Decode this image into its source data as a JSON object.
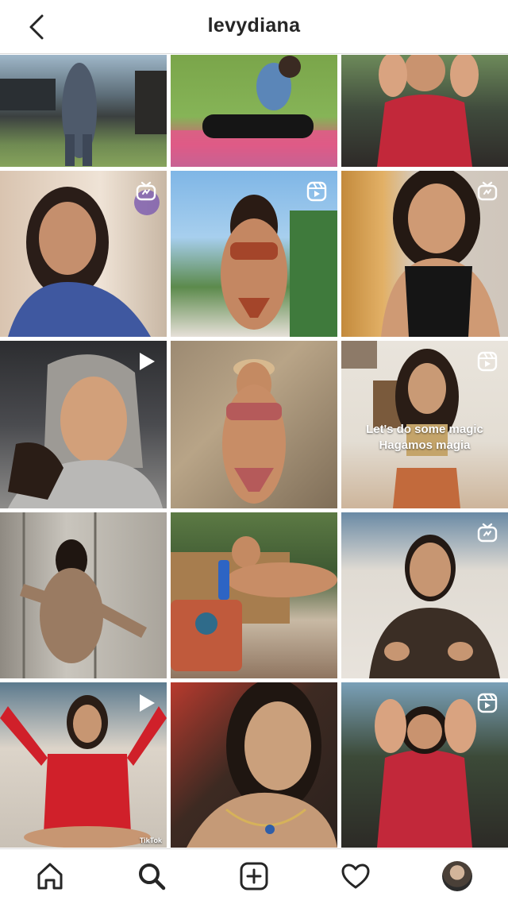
{
  "header": {
    "username": "levydiana"
  },
  "icons": {
    "back": "chevron-left-icon",
    "home": "home-icon",
    "search": "search-icon",
    "new_post": "add-post-icon",
    "activity": "heart-icon",
    "profile": "profile-avatar"
  },
  "tiles": [
    {
      "index": 1,
      "badge": "none"
    },
    {
      "index": 2,
      "badge": "none"
    },
    {
      "index": 3,
      "badge": "none"
    },
    {
      "index": 4,
      "badge": "igtv"
    },
    {
      "index": 5,
      "badge": "reels"
    },
    {
      "index": 6,
      "badge": "igtv"
    },
    {
      "index": 7,
      "badge": "video"
    },
    {
      "index": 8,
      "badge": "none"
    },
    {
      "index": 9,
      "badge": "reels",
      "overlay_line1": "Let's do some magic",
      "overlay_line2": "Hagamos magia"
    },
    {
      "index": 10,
      "badge": "none"
    },
    {
      "index": 11,
      "badge": "none"
    },
    {
      "index": 12,
      "badge": "igtv"
    },
    {
      "index": 13,
      "badge": "video",
      "watermark": "TikTok"
    },
    {
      "index": 14,
      "badge": "none"
    },
    {
      "index": 15,
      "badge": "reels"
    }
  ],
  "colors": {
    "text": "#262626",
    "divider": "#dbdbdb",
    "background": "#ffffff"
  }
}
